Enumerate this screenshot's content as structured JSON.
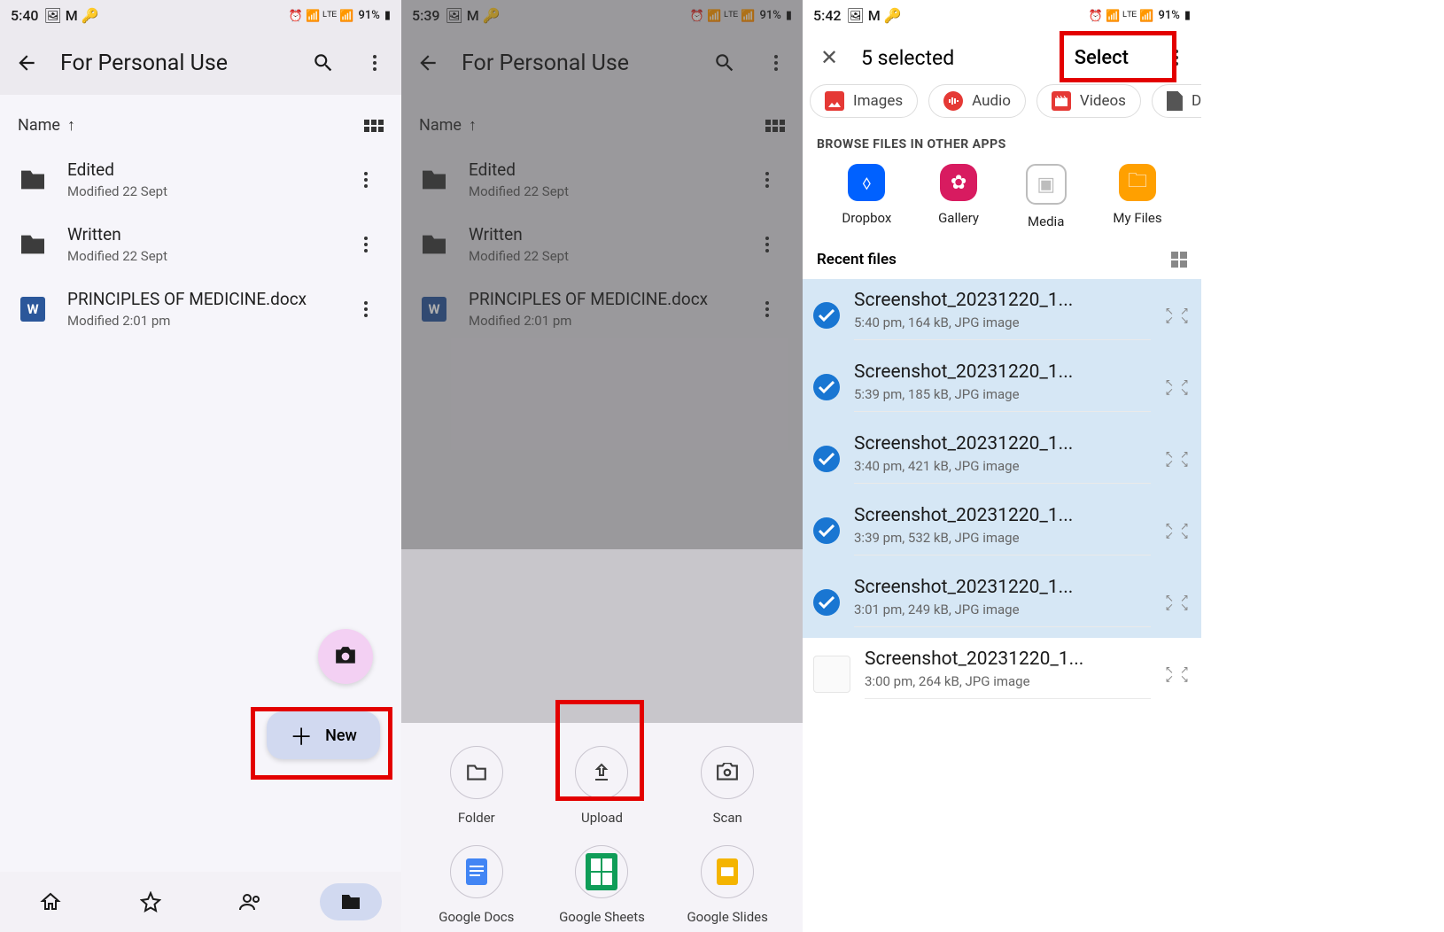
{
  "status": {
    "time1": "5:40",
    "time2": "5:39",
    "time3": "5:42",
    "battery": "91%",
    "net": "LTE"
  },
  "screen1": {
    "title": "For Personal Use",
    "sort": "Name",
    "files": [
      {
        "name": "Edited",
        "meta": "Modified 22 Sept",
        "type": "folder"
      },
      {
        "name": "Written",
        "meta": "Modified 22 Sept",
        "type": "folder"
      },
      {
        "name": "PRINCIPLES OF MEDICINE.docx",
        "meta": "Modified 2:01 pm",
        "type": "docx"
      }
    ],
    "fab_new": "New"
  },
  "screen2": {
    "title": "For Personal Use",
    "sort": "Name",
    "files": [
      {
        "name": "Edited",
        "meta": "Modified 22 Sept"
      },
      {
        "name": "Written",
        "meta": "Modified 22 Sept"
      },
      {
        "name": "PRINCIPLES OF MEDICINE.docx",
        "meta": "Modified 2:01 pm"
      }
    ],
    "sheet": [
      "Folder",
      "Upload",
      "Scan",
      "Google Docs",
      "Google Sheets",
      "Google Slides"
    ]
  },
  "screen3": {
    "selected_text": "5 selected",
    "select_btn": "Select",
    "filters": [
      "Images",
      "Audio",
      "Videos",
      "Do"
    ],
    "browse_label": "BROWSE FILES IN OTHER APPS",
    "apps": [
      {
        "name": "Dropbox",
        "color": "#0061ff"
      },
      {
        "name": "Gallery",
        "color": "#d81b60"
      },
      {
        "name": "Media",
        "color": "#bdbdbd"
      },
      {
        "name": "My Files",
        "color": "#ffa000"
      }
    ],
    "recent_label": "Recent files",
    "recent": [
      {
        "name": "Screenshot_20231220_1...",
        "meta": "5:40 pm, 164 kB, JPG image",
        "sel": true
      },
      {
        "name": "Screenshot_20231220_1...",
        "meta": "5:39 pm, 185 kB, JPG image",
        "sel": true
      },
      {
        "name": "Screenshot_20231220_1...",
        "meta": "3:40 pm, 421 kB, JPG image",
        "sel": true
      },
      {
        "name": "Screenshot_20231220_1...",
        "meta": "3:39 pm, 532 kB, JPG image",
        "sel": true
      },
      {
        "name": "Screenshot_20231220_1...",
        "meta": "3:01 pm, 249 kB, JPG image",
        "sel": true
      },
      {
        "name": "Screenshot_20231220_1...",
        "meta": "3:00 pm, 264 kB, JPG image",
        "sel": false
      }
    ]
  }
}
